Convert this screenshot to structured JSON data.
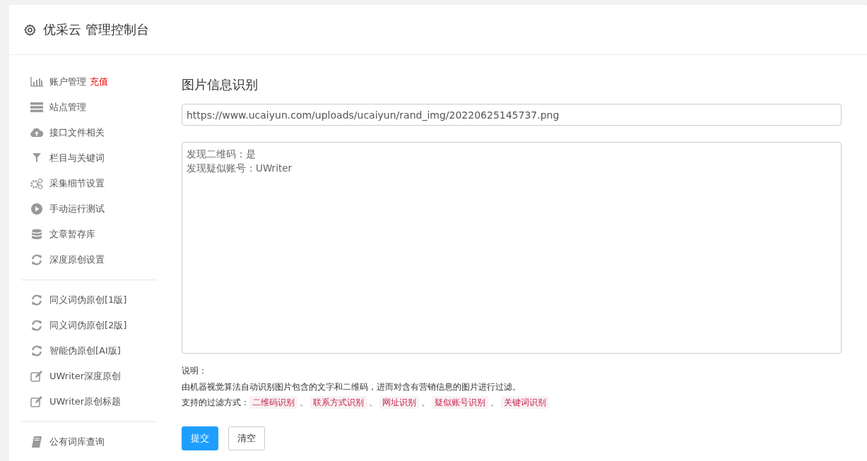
{
  "header": {
    "title": "优采云 管理控制台"
  },
  "sidebar": {
    "groups": [
      {
        "items": [
          {
            "label": "账户管理",
            "badge": "充值"
          },
          {
            "label": "站点管理"
          },
          {
            "label": "接口文件相关"
          },
          {
            "label": "栏目与关键词"
          },
          {
            "label": "采集细节设置"
          },
          {
            "label": "手动运行测试"
          },
          {
            "label": "文章暂存库"
          },
          {
            "label": "深度原创设置"
          }
        ]
      },
      {
        "items": [
          {
            "label": "同义词伪原创[1版]"
          },
          {
            "label": "同义词伪原创[2版]"
          },
          {
            "label": "智能伪原创[AI版]"
          },
          {
            "label": "UWriter深度原创"
          },
          {
            "label": "UWriter原创标题"
          }
        ]
      },
      {
        "items": [
          {
            "label": "公有词库查询"
          }
        ]
      }
    ]
  },
  "main": {
    "title": "图片信息识别",
    "url_field": {
      "value": "https://www.ucaiyun.com/uploads/ucaiyun/rand_img/20220625145737.png"
    },
    "result": [
      "发现二维码：是",
      "发现疑似账号：UWriter"
    ],
    "note_label": "说明：",
    "note_text": "由机器视觉算法自动识别图片包含的文字和二维码，进而对含有营销信息的图片进行过滤。",
    "filters_label": "支持的过滤方式：",
    "filters": [
      {
        "kind": "tag",
        "text": "二维码识别"
      },
      {
        "kind": "sep",
        "text": "、"
      },
      {
        "kind": "tag",
        "text": "联系方式识别"
      },
      {
        "kind": "sep",
        "text": "、"
      },
      {
        "kind": "tag",
        "text": "网址识别"
      },
      {
        "kind": "sep",
        "text": "、"
      },
      {
        "kind": "tag",
        "text": "疑似账号识别"
      },
      {
        "kind": "sep",
        "text": "、"
      },
      {
        "kind": "tag",
        "text": "关键词识别"
      }
    ],
    "buttons": [
      {
        "label": "提交",
        "kind": "primary"
      },
      {
        "label": "清空",
        "kind": "default"
      }
    ]
  }
}
